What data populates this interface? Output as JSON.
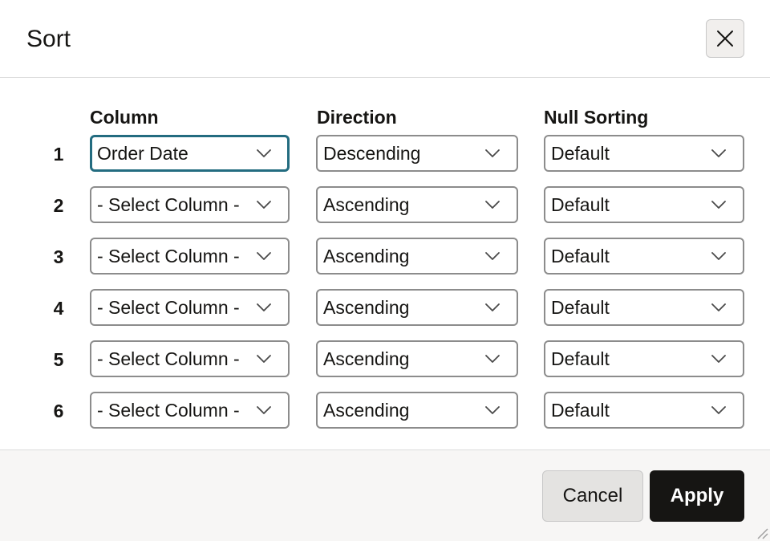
{
  "dialog": {
    "title": "Sort",
    "close_icon": "close-icon"
  },
  "columns": {
    "column": "Column",
    "direction": "Direction",
    "null_sorting": "Null Sorting"
  },
  "rows": [
    {
      "num": "1",
      "column": "Order Date",
      "direction": "Descending",
      "nulls": "Default"
    },
    {
      "num": "2",
      "column": "- Select Column -",
      "direction": "Ascending",
      "nulls": "Default"
    },
    {
      "num": "3",
      "column": "- Select Column -",
      "direction": "Ascending",
      "nulls": "Default"
    },
    {
      "num": "4",
      "column": "- Select Column -",
      "direction": "Ascending",
      "nulls": "Default"
    },
    {
      "num": "5",
      "column": "- Select Column -",
      "direction": "Ascending",
      "nulls": "Default"
    },
    {
      "num": "6",
      "column": "- Select Column -",
      "direction": "Ascending",
      "nulls": "Default"
    }
  ],
  "footer": {
    "cancel_label": "Cancel",
    "apply_label": "Apply"
  },
  "colors": {
    "focus_border": "#236c80",
    "apply_background": "#161513",
    "footer_background": "#f7f6f5"
  }
}
